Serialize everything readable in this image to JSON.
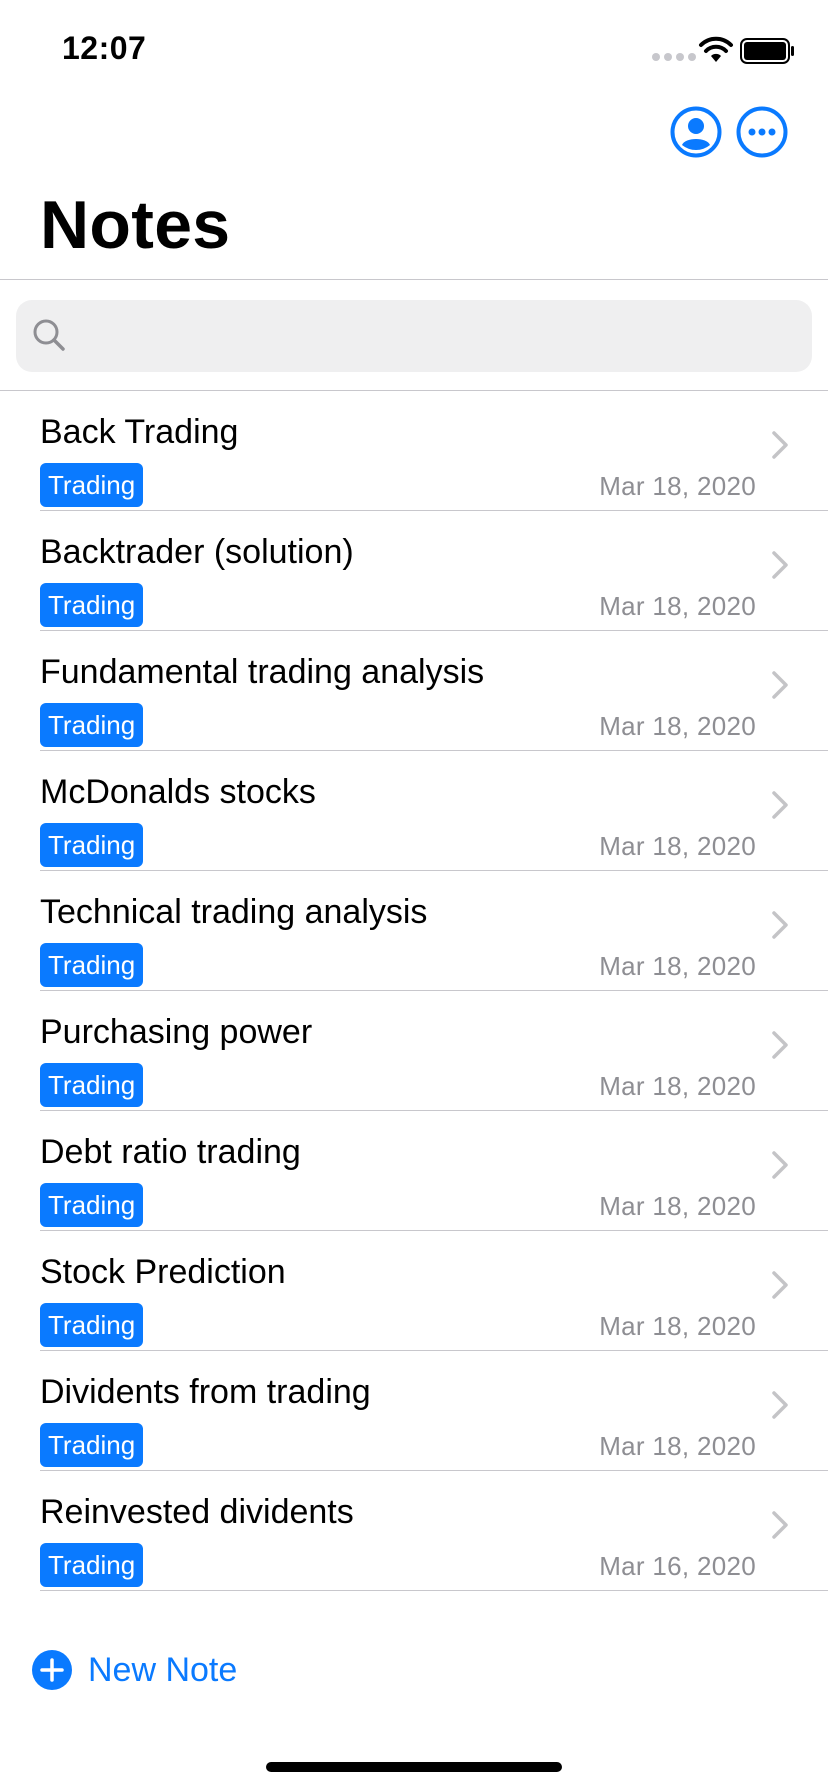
{
  "status_bar": {
    "time": "12:07"
  },
  "nav": {
    "title": "Notes",
    "profile_icon": "person-circle-icon",
    "more_icon": "ellipsis-circle-icon"
  },
  "search": {
    "placeholder": ""
  },
  "colors": {
    "accent": "#0a7aff",
    "secondary_text": "#8e8e93",
    "separator": "#c8c7cc"
  },
  "notes": [
    {
      "title": "Back Trading",
      "tag": "Trading",
      "date": "Mar 18, 2020"
    },
    {
      "title": "Backtrader (solution)",
      "tag": "Trading",
      "date": "Mar 18, 2020"
    },
    {
      "title": "Fundamental trading analysis",
      "tag": "Trading",
      "date": "Mar 18, 2020"
    },
    {
      "title": "McDonalds stocks",
      "tag": "Trading",
      "date": "Mar 18, 2020"
    },
    {
      "title": "Technical trading analysis",
      "tag": "Trading",
      "date": "Mar 18, 2020"
    },
    {
      "title": "Purchasing power",
      "tag": "Trading",
      "date": "Mar 18, 2020"
    },
    {
      "title": "Debt ratio trading",
      "tag": "Trading",
      "date": "Mar 18, 2020"
    },
    {
      "title": "Stock Prediction",
      "tag": "Trading",
      "date": "Mar 18, 2020"
    },
    {
      "title": "Dividents from trading",
      "tag": "Trading",
      "date": "Mar 18, 2020"
    },
    {
      "title": "Reinvested dividents",
      "tag": "Trading",
      "date": "Mar 16, 2020"
    }
  ],
  "footer": {
    "new_note_label": "New Note"
  }
}
